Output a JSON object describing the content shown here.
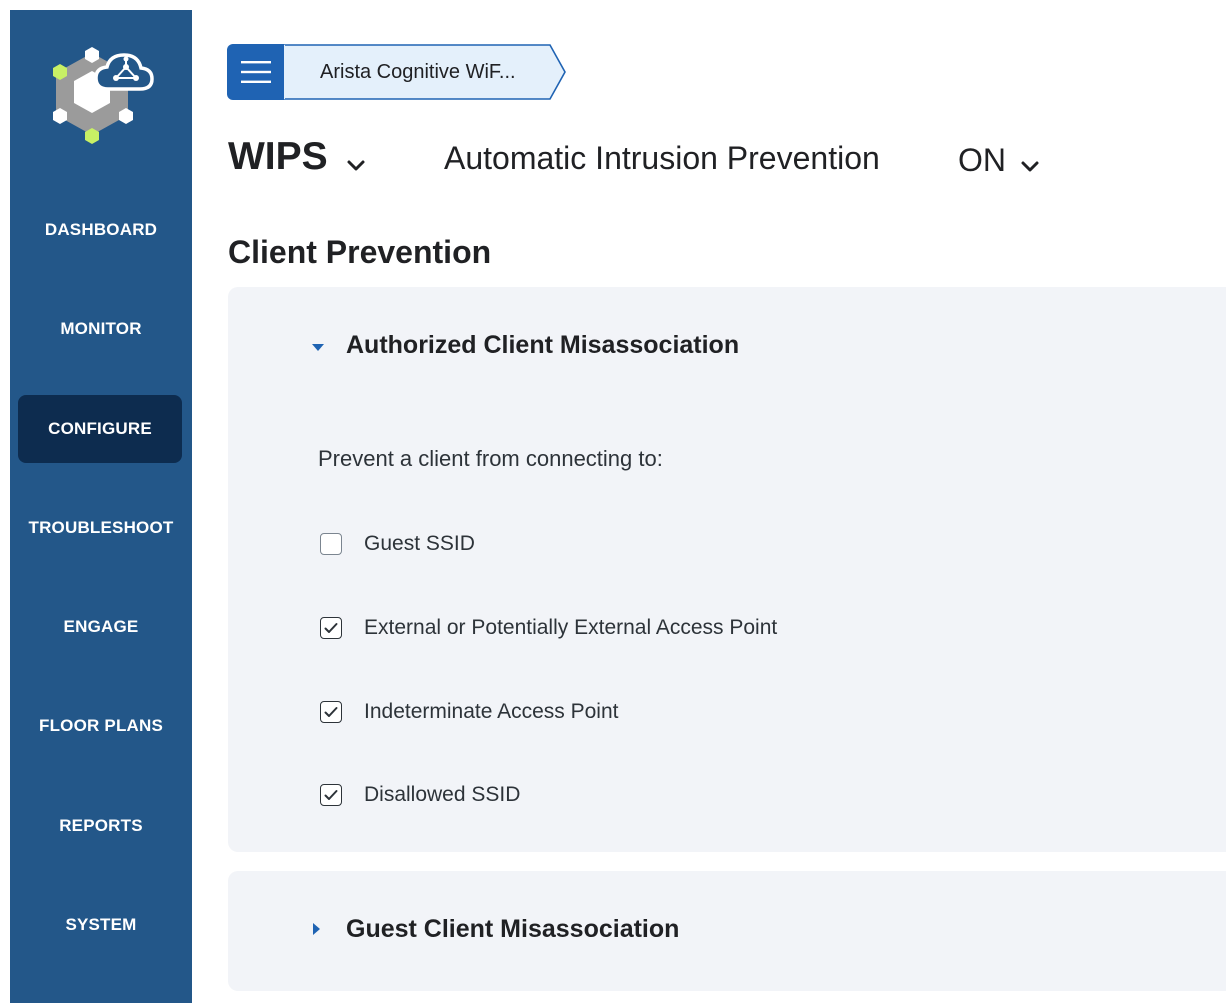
{
  "breadcrumb": {
    "label": "Arista Cognitive WiF..."
  },
  "header": {
    "module_title": "WIPS",
    "auto_prevention_label": "Automatic Intrusion Prevention",
    "auto_prevention_value": "ON"
  },
  "sidebar": {
    "items": [
      {
        "label": "DASHBOARD",
        "active": false
      },
      {
        "label": "MONITOR",
        "active": false
      },
      {
        "label": "CONFIGURE",
        "active": true
      },
      {
        "label": "TROUBLESHOOT",
        "active": false
      },
      {
        "label": "ENGAGE",
        "active": false
      },
      {
        "label": "FLOOR PLANS",
        "active": false
      },
      {
        "label": "REPORTS",
        "active": false
      },
      {
        "label": "SYSTEM",
        "active": false
      }
    ]
  },
  "main": {
    "section_title": "Client Prevention",
    "panels": [
      {
        "title": "Authorized Client Misassociation",
        "expanded": true,
        "prompt": "Prevent a client from connecting to:",
        "options": [
          {
            "label": "Guest SSID",
            "checked": false
          },
          {
            "label": "External or Potentially External Access Point",
            "checked": true
          },
          {
            "label": "Indeterminate Access Point",
            "checked": true
          },
          {
            "label": "Disallowed SSID",
            "checked": true
          }
        ]
      },
      {
        "title": "Guest Client Misassociation",
        "expanded": false
      }
    ]
  },
  "colors": {
    "sidebar_bg": "#235789",
    "sidebar_active_bg": "#0d2c4f",
    "accent_blue": "#1f63b3",
    "breadcrumb_bg": "#e4f0fb",
    "panel_bg": "#f2f4f8",
    "logo_green": "#c8f065"
  },
  "icons": {
    "menu": "hamburger-icon",
    "module_dropdown": "chevron-down-icon",
    "expanded": "caret-down-icon",
    "collapsed": "caret-right-icon",
    "checked": "checkmark-icon",
    "logo": "cloud-network-logo"
  }
}
